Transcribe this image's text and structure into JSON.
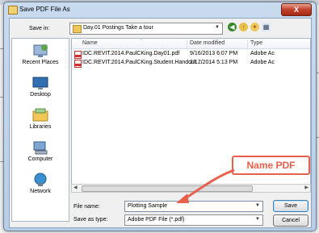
{
  "dialog": {
    "title": "Save PDF File As",
    "close_label": "X"
  },
  "save_in": {
    "label": "Save in:",
    "value": "Day.01 Postings Take a tour"
  },
  "places": [
    {
      "label": "Recent Places",
      "icon": "recent-places-icon"
    },
    {
      "label": "Desktop",
      "icon": "desktop-icon"
    },
    {
      "label": "Libraries",
      "icon": "libraries-icon"
    },
    {
      "label": "Computer",
      "icon": "computer-icon"
    },
    {
      "label": "Network",
      "icon": "network-icon"
    }
  ],
  "file_list": {
    "columns": {
      "name": "Name",
      "date": "Date modified",
      "type": "Type"
    },
    "rows": [
      {
        "name": "IDC.REVIT.2014.PaulCKing.Day01.pdf",
        "date": "9/16/2013 6:07 PM",
        "type": "Adobe Ac"
      },
      {
        "name": "IDC.REVIT.2014.PaulCKing.Student.Handout....",
        "date": "2/17/2014 5:13 PM",
        "type": "Adobe Ac"
      }
    ]
  },
  "file_name": {
    "label": "File name:",
    "value": "Plotting Sample"
  },
  "save_as_type": {
    "label": "Save as type:",
    "value": "Adobe PDF File (*.pdf)"
  },
  "buttons": {
    "save": "Save",
    "cancel": "Cancel"
  },
  "annotation": {
    "text": "Name PDF",
    "color": "#e8604c"
  }
}
